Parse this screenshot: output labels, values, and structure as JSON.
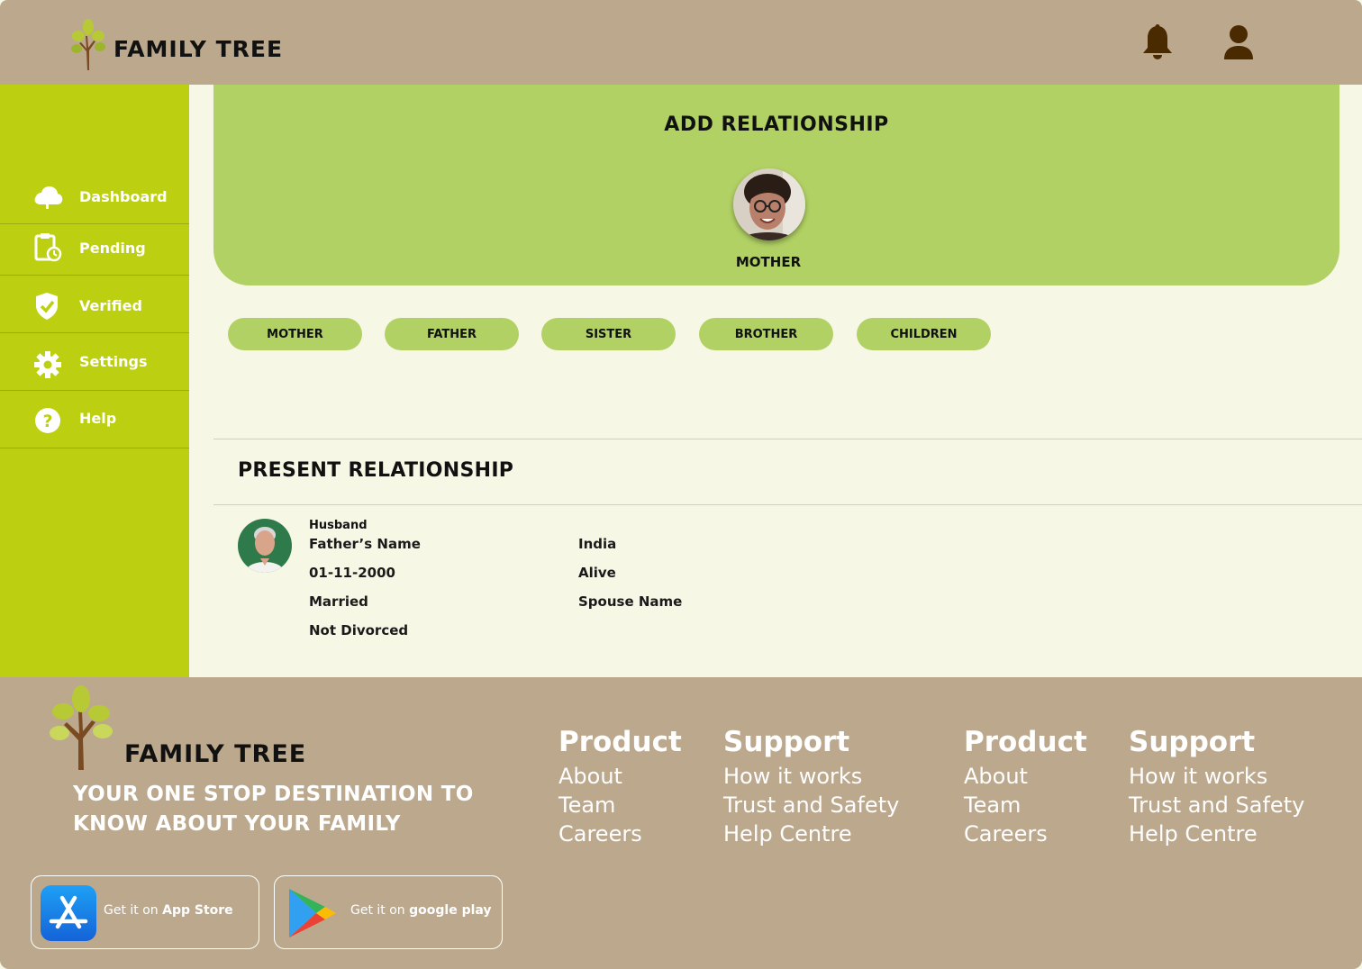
{
  "header": {
    "brand": "FAMILY TREE",
    "icons": [
      "bell-icon",
      "user-icon"
    ]
  },
  "sidebar": {
    "items": [
      {
        "label": "Dashboard",
        "icon": "cloud-icon"
      },
      {
        "label": "Pending",
        "icon": "clipboard-clock-icon"
      },
      {
        "label": "Verified",
        "icon": "shield-check-icon"
      },
      {
        "label": "Settings",
        "icon": "gear-icon"
      },
      {
        "label": "Help",
        "icon": "question-icon"
      }
    ]
  },
  "add_relationship": {
    "title": "ADD RELATIONSHIP",
    "selected_label": "MOTHER",
    "options": [
      "MOTHER",
      "FATHER",
      "SISTER",
      "BROTHER",
      "CHILDREN"
    ]
  },
  "present_relationship": {
    "title": "PRESENT RELATIONSHIP",
    "role": "Husband",
    "left_details": [
      "Father’s Name",
      "01-11-2000",
      "Married",
      "Not Divorced"
    ],
    "right_details": [
      "India",
      "Alive",
      "Spouse Name"
    ]
  },
  "footer": {
    "brand": "FAMILY TREE",
    "tagline_line1": "YOUR ONE STOP DESTINATION TO",
    "tagline_line2": "KNOW ABOUT YOUR FAMILY",
    "columns": [
      {
        "title": "Product",
        "links": [
          "About",
          "Team",
          "Careers"
        ]
      },
      {
        "title": "Support",
        "links": [
          "How it works",
          "Trust and Safety",
          "Help Centre"
        ]
      },
      {
        "title": "Product",
        "links": [
          "About",
          "Team",
          "Careers"
        ]
      },
      {
        "title": "Support",
        "links": [
          "How it works",
          "Trust and Safety",
          "Help Centre"
        ]
      }
    ],
    "app_store": {
      "prefix": "Get it on",
      "name": "App Store"
    },
    "google_play": {
      "prefix": "Get it on",
      "name": "google play"
    }
  },
  "colors": {
    "header_bg": "#bca98d",
    "sidebar_bg": "#bccf10",
    "panel_green": "#b1d164",
    "page_bg": "#f7f7e6",
    "icon_brown": "#4a2a00"
  }
}
